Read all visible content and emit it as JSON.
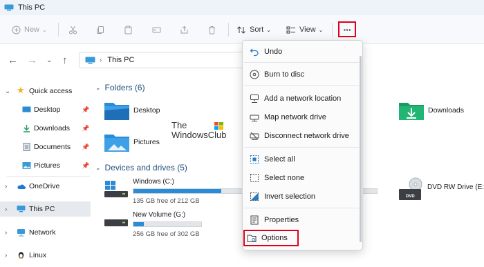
{
  "window": {
    "title": "This PC"
  },
  "toolbar": {
    "new_label": "New",
    "sort_label": "Sort",
    "view_label": "View",
    "more_label": "···"
  },
  "address": {
    "location": "This PC"
  },
  "sidebar": {
    "items": [
      {
        "label": "Quick access"
      },
      {
        "label": "Desktop"
      },
      {
        "label": "Downloads"
      },
      {
        "label": "Documents"
      },
      {
        "label": "Pictures"
      },
      {
        "label": "OneDrive"
      },
      {
        "label": "This PC"
      },
      {
        "label": "Network"
      },
      {
        "label": "Linux"
      }
    ]
  },
  "main": {
    "folders_header": "Folders (6)",
    "folders": [
      {
        "label": "Desktop"
      },
      {
        "label": "Downloads"
      },
      {
        "label": "Pictures"
      }
    ],
    "drives_header": "Devices and drives (5)",
    "drives": [
      {
        "name": "Windows (C:)",
        "free": "135 GB free of 212 GB",
        "used_fraction": 0.36
      },
      {
        "name": "New Volume (G:)",
        "free": "256 GB free of 302 GB",
        "used_fraction": 0.15
      },
      {
        "name": "DVD RW Drive (E:)"
      }
    ],
    "drive_badge": "DVD"
  },
  "watermark": {
    "line1": "The",
    "line2": "WindowsClub"
  },
  "menu": {
    "items": [
      {
        "label": "Undo",
        "icon": "undo-icon"
      },
      {
        "label": "Burn to disc",
        "icon": "burn-disc-icon"
      },
      {
        "label": "Add a network location",
        "icon": "network-location-icon"
      },
      {
        "label": "Map network drive",
        "icon": "map-drive-icon"
      },
      {
        "label": "Disconnect network drive",
        "icon": "disconnect-drive-icon"
      },
      {
        "label": "Select all",
        "icon": "select-all-icon"
      },
      {
        "label": "Select none",
        "icon": "select-none-icon"
      },
      {
        "label": "Invert selection",
        "icon": "invert-selection-icon"
      },
      {
        "label": "Properties",
        "icon": "properties-icon"
      },
      {
        "label": "Options",
        "icon": "options-icon"
      }
    ]
  },
  "colors": {
    "accent": "#2a8bd6",
    "highlight_box": "#e0001b",
    "group_header": "#1f4e7e"
  }
}
